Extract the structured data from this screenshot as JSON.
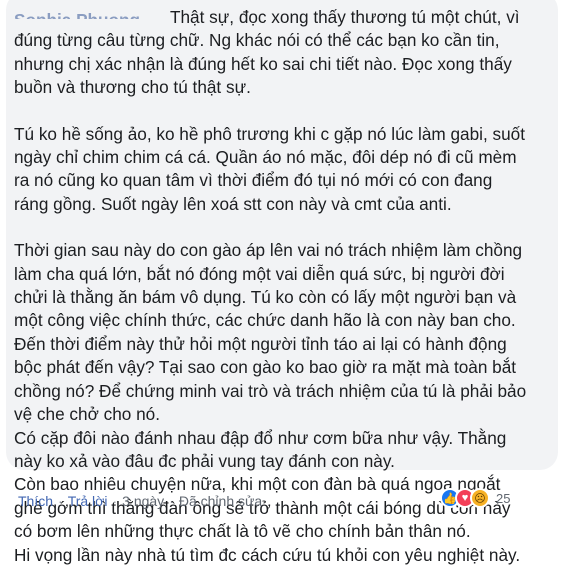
{
  "comment": {
    "author": "Sophia Phuong Le",
    "paragraphs": [
      "Thật sự, đọc xong thấy thương tú một chút, vì\nđúng từng câu từng chữ. Ng khác nói có thể các bạn ko cần tin,\nnhưng chị xác nhận là đúng hết ko sai chi tiết nào. Đọc xong thấy\nbuồn và thương cho tú thật sự.",
      "Tú ko hề sống ảo, ko hề phô trương khi c gặp nó lúc làm gabi, suốt\nngày chỉ chim chim cá cá. Quần áo nó mặc, đôi dép nó đi cũ mèm\nra nó cũng ko quan tâm vì thời điểm đó tụi nó mới có con đang\nráng gồng. Suốt ngày lên xoá stt con này và cmt của anti.",
      "Thời gian sau này do con gào áp lên vai nó trách nhiệm làm chồng\nlàm cha quá lớn, bắt nó đóng một vai diễn quá sức, bị người đời\nchửi là thằng ăn bám vô dụng. Tú ko còn có lấy một người bạn và\nmột công việc chính thức, các chức danh hão là con này ban cho.\nĐến thời điểm này thử hỏi một người tỉnh táo ai lại có hành động\nbộc phát đến vậy? Tại sao con gào ko bao giờ ra mặt mà toàn bắt\nchồng nó? Để chứng minh vai trò và trách nhiệm của tú là phải bảo\nvệ che chở cho nó.\nCó cặp đôi nào đánh nhau đập đổ như cơm bữa như vậy. Thằng\nnày ko xả vào đâu đc phải vung tay đánh con này.\nCòn bao nhiêu chuyện nữa, khi một con đàn bà quá ngoa ngoắt\nghê gớm thì thằng đàn ông sẽ trở thành một cái bóng dù con này\ncó bơm lên những thực chất là tô vẽ cho chính bản thân nó.\nHi vọng lần này nhà tú tìm đc cách cứu tú khỏi con yêu nghiệt này."
    ]
  },
  "actions": {
    "like": "Thích",
    "reply": "Trả lời",
    "time": "3 ngày",
    "edited": "Đã chỉnh sửa",
    "separator": "·"
  },
  "reactions": {
    "icons": [
      "like-icon",
      "love-icon",
      "sad-icon"
    ],
    "count": "25"
  },
  "colors": {
    "bubble": "#f2f3f5",
    "text": "#1c1e21",
    "link": "#4267b2",
    "meta": "#606770"
  }
}
